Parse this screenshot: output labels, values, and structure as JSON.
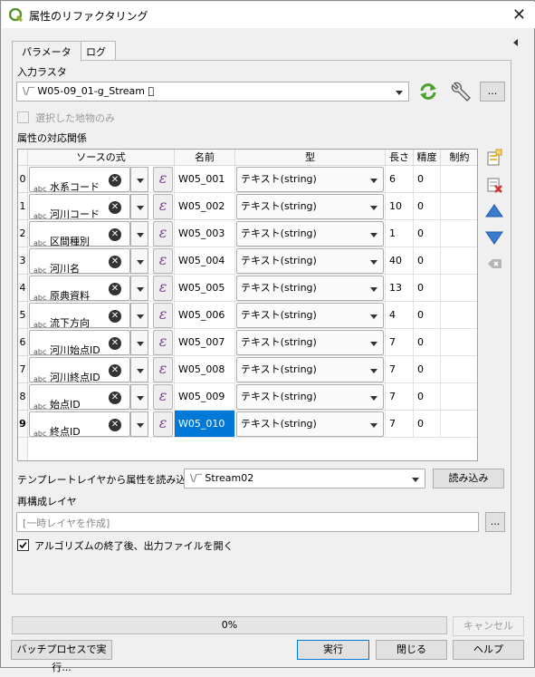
{
  "window": {
    "title": "属性のリファクタリング"
  },
  "tabs": [
    {
      "label": "パラメータ"
    },
    {
      "label": "ログ"
    }
  ],
  "input_raster": {
    "label": "入力ラスタ",
    "value": "W05-09_01-g_Stream ⃞"
  },
  "selected_only": {
    "label": "選択した地物のみ",
    "checked": false
  },
  "mapping": {
    "label": "属性の対応関係",
    "columns": {
      "source": "ソースの式",
      "name": "名前",
      "type": "型",
      "length": "長さ",
      "precision": "精度",
      "constraint": "制約"
    },
    "rows": [
      {
        "index": "0",
        "source": "水系コード",
        "name": "W05_001",
        "type": "テキスト(string)",
        "length": "6",
        "precision": "0"
      },
      {
        "index": "1",
        "source": "河川コード",
        "name": "W05_002",
        "type": "テキスト(string)",
        "length": "10",
        "precision": "0"
      },
      {
        "index": "2",
        "source": "区間種別",
        "name": "W05_003",
        "type": "テキスト(string)",
        "length": "1",
        "precision": "0"
      },
      {
        "index": "3",
        "source": "河川名",
        "name": "W05_004",
        "type": "テキスト(string)",
        "length": "40",
        "precision": "0"
      },
      {
        "index": "4",
        "source": "原典資料",
        "name": "W05_005",
        "type": "テキスト(string)",
        "length": "13",
        "precision": "0"
      },
      {
        "index": "5",
        "source": "流下方向",
        "name": "W05_006",
        "type": "テキスト(string)",
        "length": "4",
        "precision": "0"
      },
      {
        "index": "6",
        "source": "河川始点ID",
        "name": "W05_007",
        "type": "テキスト(string)",
        "length": "7",
        "precision": "0"
      },
      {
        "index": "7",
        "source": "河川終点ID",
        "name": "W05_008",
        "type": "テキスト(string)",
        "length": "7",
        "precision": "0"
      },
      {
        "index": "8",
        "source": "始点ID",
        "name": "W05_009",
        "type": "テキスト(string)",
        "length": "7",
        "precision": "0"
      },
      {
        "index": "9",
        "source": "終点ID",
        "name": "W05_010",
        "type": "テキスト(string)",
        "length": "7",
        "precision": "0",
        "selected": true
      }
    ],
    "abc_tag": "abc",
    "clear_glyph": "✕",
    "expr_glyph": "ε"
  },
  "template": {
    "label": "テンプレートレイヤから属性を読み込む",
    "value": "Stream02",
    "load_button": "読み込み"
  },
  "output": {
    "label": "再構成レイヤ",
    "placeholder": "[一時レイヤを作成]",
    "browse": "..."
  },
  "open_output": {
    "label": "アルゴリズムの終了後、出力ファイルを開く",
    "checked": true
  },
  "progress": {
    "text": "0%",
    "value": 0
  },
  "buttons": {
    "cancel": "キャンセル",
    "batch": "バッチプロセスで実行...",
    "run": "実行",
    "close": "閉じる",
    "help": "ヘルプ",
    "more": "..."
  },
  "colors": {
    "accent": "#0078d7",
    "selected_cell": "#0078d7",
    "qgis_green": "#6aa84f"
  }
}
